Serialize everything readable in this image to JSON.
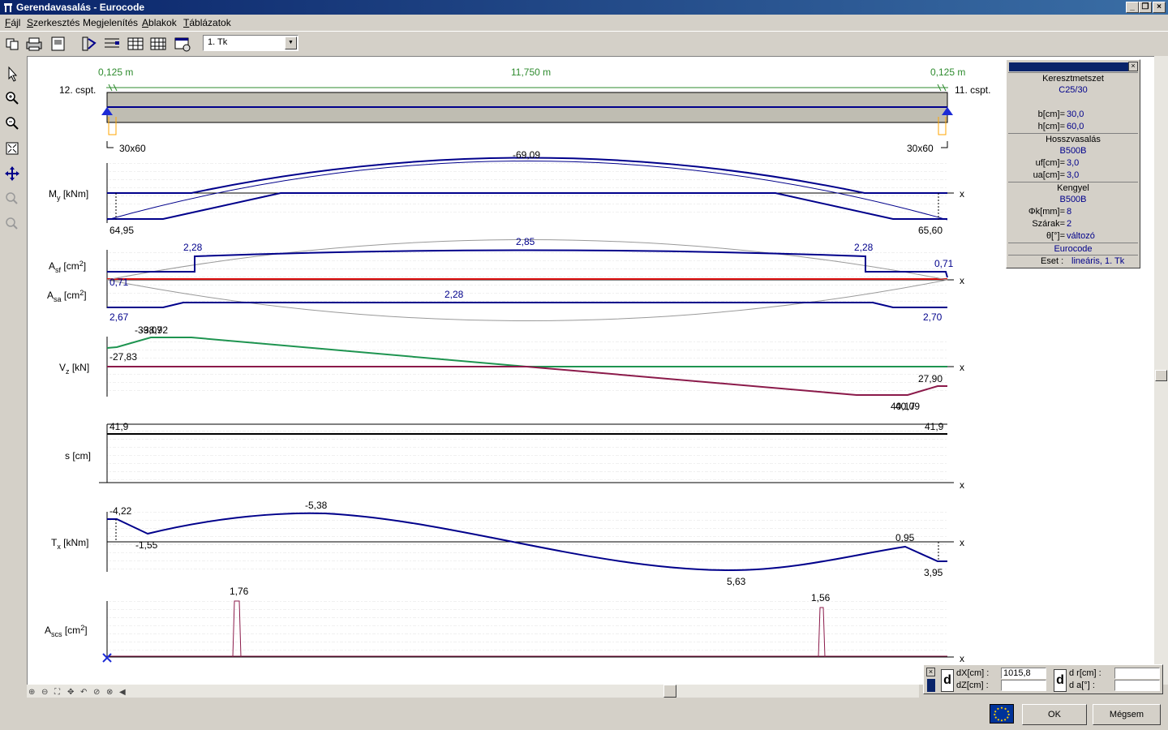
{
  "window": {
    "title": "Gerendavasalás - Eurocode"
  },
  "menu": [
    {
      "pre": "",
      "u": "F",
      "post": "ájl"
    },
    {
      "pre": "",
      "u": "S",
      "post": "zerkesztés"
    },
    {
      "pre": "Me",
      "u": "g",
      "post": "jelenítés"
    },
    {
      "pre": "",
      "u": "A",
      "post": "blakok"
    },
    {
      "pre": "",
      "u": "T",
      "post": "áblázatok"
    }
  ],
  "toolbar": {
    "combo_value": "1. Tk"
  },
  "beam": {
    "left_dim": "0,125 m",
    "mid_dim": "11,750 m",
    "right_dim": "0,125 m",
    "left_node": "12. cspt.",
    "right_node": "11. cspt.",
    "left_section": "30x60",
    "right_section": "30x60"
  },
  "diagrams": {
    "my": {
      "label": "M",
      "sub": "y",
      "unit": " [kNm]",
      "v_max": "-69,09",
      "v_left": "64,95",
      "v_right": "65,60"
    },
    "as": {
      "label_top": "A",
      "sub_top": "sf",
      "unit_top": " [cm",
      "label_bot": "A",
      "sub_bot": "sa",
      "unit_bot": " [cm",
      "sup": "2",
      "close": "]",
      "v_top_l": "2,28",
      "v_top_m": "2,85",
      "v_top_r": "2,28",
      "v_top_end": "0,71",
      "v_left_07": "0,71",
      "v_bot_m": "2,28",
      "v_bot_l": "2,67",
      "v_bot_r": "2,70"
    },
    "vz": {
      "label": "V",
      "sub": "z",
      "unit": " [kN]",
      "v_top_a": "-39,07",
      "v_top_b": "-38,92",
      "v_left": "-27,83",
      "v_right": "27,90",
      "v_bot_a": "40,17",
      "v_bot_b": "40,09"
    },
    "s": {
      "label": "s [cm]",
      "v_left": "41,9",
      "v_right": "41,9"
    },
    "tx": {
      "label": "T",
      "sub": "x",
      "unit": " [kNm]",
      "v_l1": "-4,22",
      "v_l2": "-1,55",
      "v_m": "-5,38",
      "v_low": "5,63",
      "v_r1": "0,95",
      "v_r2": "3,95"
    },
    "ascs": {
      "label": "A",
      "sub": "scs",
      "unit": " [cm",
      "sup": "2",
      "close": "]",
      "v1": "1,76",
      "v2": "1,56"
    },
    "axis_x": "x"
  },
  "panel": {
    "sec1": "Keresztmetszet",
    "concrete": "C25/30",
    "b_lbl": "b[cm]=",
    "b_val": "30,0",
    "h_lbl": "h[cm]=",
    "h_val": "60,0",
    "sec2": "Hosszvasalás",
    "steel1": "B500B",
    "uf_lbl": "uf[cm]=",
    "uf_val": "3,0",
    "ua_lbl": "ua[cm]=",
    "ua_val": "3,0",
    "sec3": "Kengyel",
    "steel2": "B500B",
    "phi_lbl": "Φk[mm]=",
    "phi_val": "8",
    "szarak_lbl": "Szárak=",
    "szarak_val": "2",
    "theta_lbl": "θ[°]=",
    "theta_val": "változó",
    "code": "Eurocode",
    "eset_lbl": "Eset :",
    "eset_val": "lineáris, 1. Tk"
  },
  "coords": {
    "dx_lbl": "dX[cm] :",
    "dx_val": "1015,8",
    "dz_lbl": "dZ[cm] :",
    "dz_val": "",
    "dr_lbl": "d r[cm] :",
    "dr_val": "",
    "da_lbl": "d   a[°] :",
    "da_val": "",
    "d1": "d",
    "d2": "d"
  },
  "buttons": {
    "ok": "OK",
    "cancel": "Mégsem"
  }
}
